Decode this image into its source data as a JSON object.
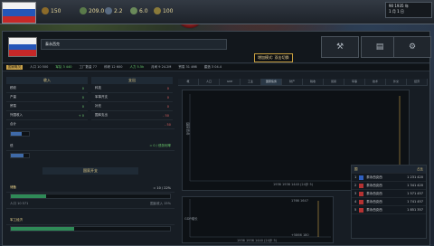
{
  "topbar": {
    "resources": [
      {
        "icon": "political-power-icon",
        "value": "150",
        "color": "#e4d69a"
      },
      {
        "icon": "stability-icon",
        "value": "209.0",
        "color": "#e4d69a"
      },
      {
        "icon": "war-support-icon",
        "value": "2.2",
        "color": "#e4d69a"
      },
      {
        "icon": "manpower-icon",
        "value": "6.0",
        "color": "#e4d69a"
      },
      {
        "icon": "factory-icon",
        "value": "100",
        "color": "#e4d69a"
      }
    ],
    "date_line1": "90 1935 年",
    "date_line2": "1 月 1 日"
  },
  "window": {
    "name_value": "泰永西克",
    "tooltip": "增加模式: 双击切换"
  },
  "statbar": {
    "items": [
      "国家概况",
      "人口 10 500",
      "军队 3 440",
      "工厂数量 77",
      "科研 12 600",
      "人力 5.5k",
      "月间 9 24.2M",
      "贸易 31 466",
      "建造 3 04.4"
    ]
  },
  "left": {
    "col1_header": "收入",
    "col2_header": "支出",
    "col1_rows": [
      {
        "label": "税收",
        "value": "0"
      },
      {
        "label": "产量",
        "value": "0"
      },
      {
        "label": "贸易",
        "value": "0"
      },
      {
        "label": "外国收入",
        "value": "+ 0"
      }
    ],
    "col2_rows": [
      {
        "label": "科技",
        "value": "0"
      },
      {
        "label": "军事开支",
        "value": "0"
      },
      {
        "label": "补充",
        "value": "0"
      },
      {
        "label": "国库支出",
        "value": "- 50"
      }
    ],
    "total_label": "合计",
    "total_value": "- 50",
    "loan_label": "债",
    "loan_value": "= 0 / 债务利率",
    "section2_header": "国家开支",
    "section2_label": "储备",
    "section2_value": "= 10 / 22%",
    "section2_sub": "人口 10 571",
    "section2_sub_value": "国民收入 15%",
    "section3_label": "军工经济"
  },
  "right": {
    "tabs": [
      "概",
      "人口",
      "GDP",
      "工业",
      "国家债务",
      "财产",
      "税收",
      "贸易",
      "军事",
      "技术",
      "外交",
      "经济"
    ],
    "active_tab": "国家债务",
    "chart1_ylabel": "国家债务",
    "chart1_xlabel": "1936 1936 1440 (24步 5)",
    "chart2_ylabel": "GDP增长",
    "chart2_xlabel": "1936 1936 1440 (24步 5)",
    "chart2_top_value": "1766 1647",
    "chart2_bottom_value": "+5866 180"
  },
  "side_panel": {
    "header1": "国",
    "header2": "占比",
    "rows": [
      {
        "rank": "1",
        "name": "泰永西克西",
        "value": "1 231 420",
        "color": "#2e5fbf"
      },
      {
        "rank": "2",
        "name": "泰永西克西",
        "value": "1 341 420",
        "color": "#b53232"
      },
      {
        "rank": "3",
        "name": "泰永西克西",
        "value": "1 571 457",
        "color": "#b53232"
      },
      {
        "rank": "4",
        "name": "泰永西克西",
        "value": "1 741 457",
        "color": "#b53232"
      },
      {
        "rank": "5",
        "name": "泰永西克西",
        "value": "1 851 357",
        "color": "#b53232"
      }
    ]
  }
}
